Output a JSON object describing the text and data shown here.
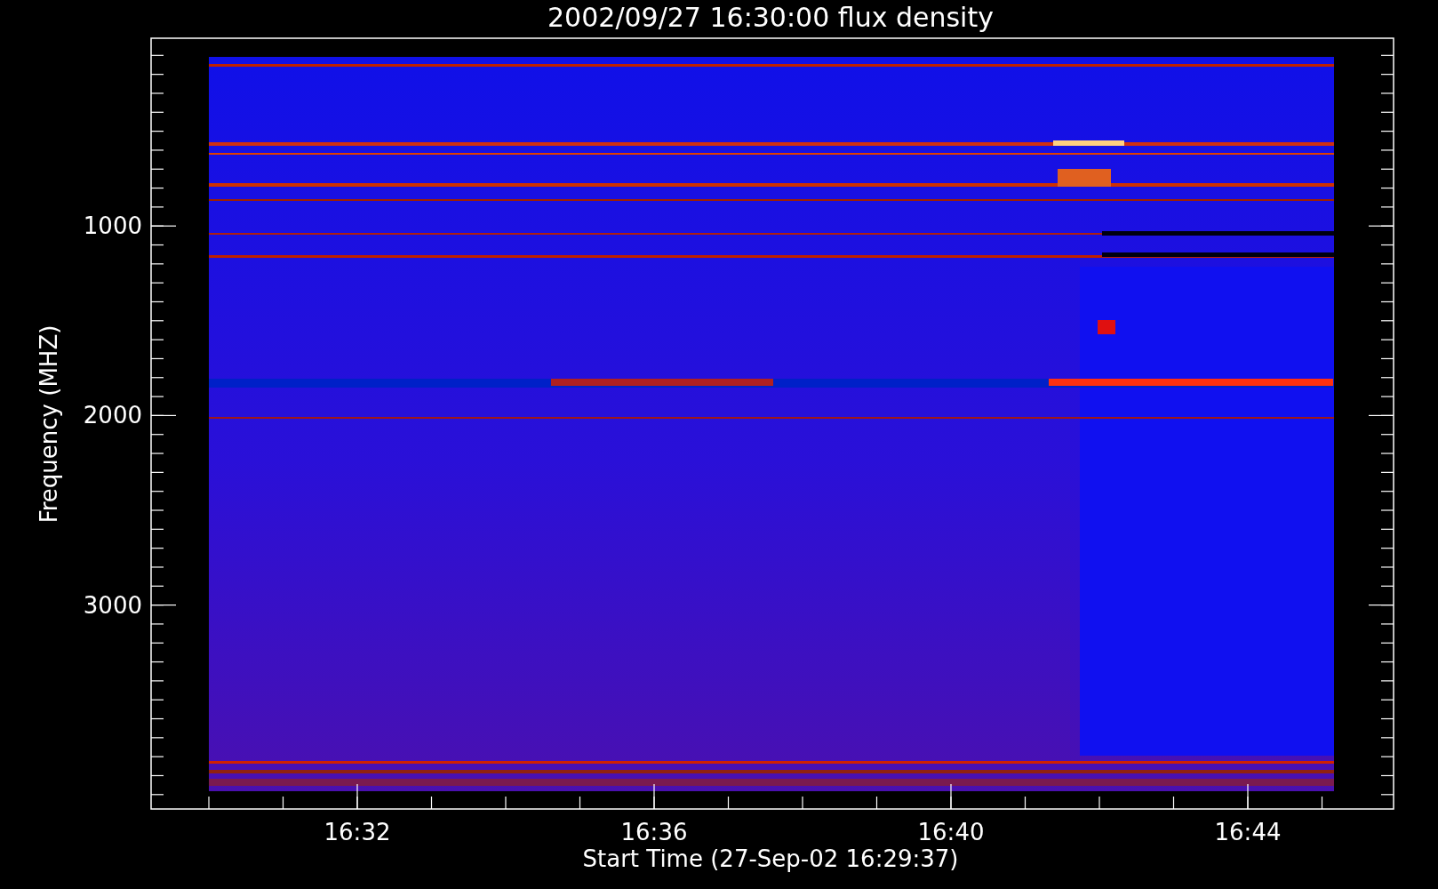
{
  "plot": {
    "title": "2002/09/27 16:30:00 flux density",
    "ylabel": "Frequency (MHZ)",
    "xlabel": "Start Time (27-Sep-02 16:29:37)",
    "yticks": [
      "1000",
      "2000",
      "3000"
    ],
    "xticks": [
      "16:32",
      "16:36",
      "16:40",
      "16:44"
    ]
  }
}
